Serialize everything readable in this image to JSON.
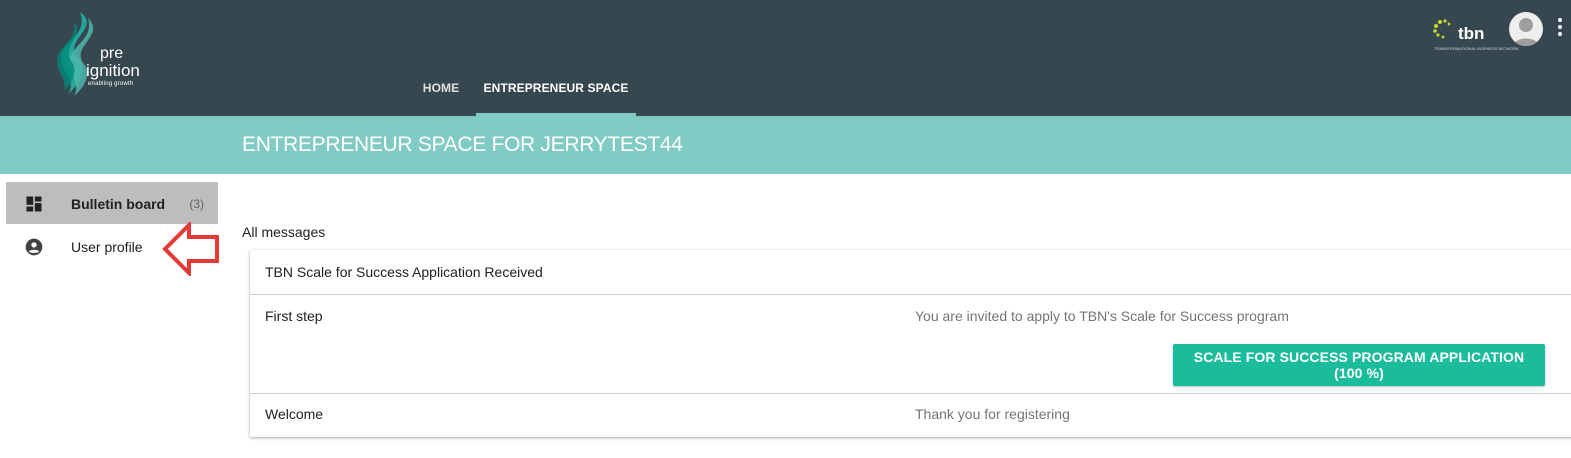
{
  "brand": {
    "logo_pre": "pre",
    "logo_ignition": "ignition",
    "logo_tagline": "enabling growth",
    "partner_logo": "tbn",
    "partner_tagline": "TRANSFORMATIONAL BUSINESS NETWORK"
  },
  "nav": {
    "tabs": [
      {
        "label": "HOME",
        "active": false
      },
      {
        "label": "ENTREPRENEUR SPACE",
        "active": true
      }
    ]
  },
  "banner": {
    "title": "ENTREPRENEUR SPACE FOR JERRYTEST44"
  },
  "sidebar": {
    "items": [
      {
        "label": "Bulletin board",
        "count": "(3)",
        "icon": "dashboard-icon",
        "active": true
      },
      {
        "label": "User profile",
        "icon": "account-circle-icon",
        "active": false
      }
    ]
  },
  "messages": {
    "section_label": "All messages",
    "header": "TBN Scale for Success Application Received",
    "rows": [
      {
        "title": "First step",
        "text": "You are invited to apply to TBN's Scale for Success program",
        "button": "SCALE FOR SUCCESS PROGRAM APPLICATION (100 %)"
      },
      {
        "title": "Welcome",
        "text": "Thank you for registering"
      }
    ]
  },
  "colors": {
    "topbar": "#37474f",
    "banner": "#80cbc4",
    "accent_button": "#1abc9c",
    "active_sidebar": "#bdbdbd",
    "annotation_arrow": "#e53935"
  }
}
